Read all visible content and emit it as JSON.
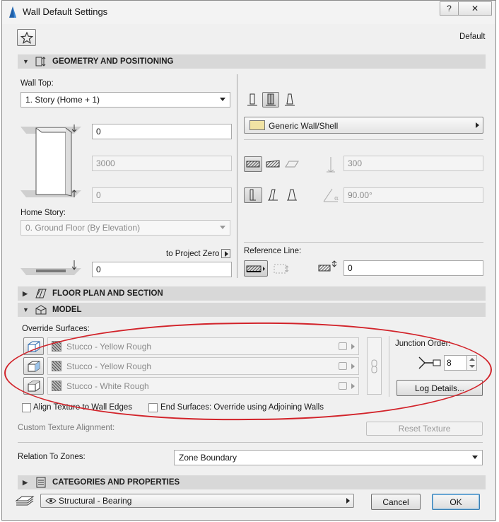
{
  "window": {
    "title": "Wall Default Settings",
    "help_label": "?",
    "close_label": "✕"
  },
  "header": {
    "favorite_icon": "star-icon",
    "default_label": "Default"
  },
  "geometry": {
    "section_label": "GEOMETRY AND POSITIONING",
    "wall_top_label": "Wall Top:",
    "wall_top_value": "1. Story (Home + 1)",
    "top_offset_value": "0",
    "height_value": "3000",
    "bottom_offset_value": "0",
    "home_story_label": "Home Story:",
    "home_story_value": "0. Ground Floor (By Elevation)",
    "to_project_zero_label": "to Project Zero",
    "project_zero_value": "0",
    "composite_value": "Generic Wall/Shell",
    "thickness_value": "300",
    "angle_value": "90.00°",
    "reference_line_label": "Reference Line:",
    "reference_offset_value": "0"
  },
  "floor_plan": {
    "section_label": "FLOOR PLAN AND SECTION"
  },
  "model": {
    "section_label": "MODEL",
    "override_surfaces_label": "Override Surfaces:",
    "surfaces": [
      "Stucco - Yellow Rough",
      "Stucco - Yellow Rough",
      "Stucco - White Rough"
    ],
    "junction_order_label": "Junction Order:",
    "junction_order_value": "8",
    "log_details_label": "Log Details...",
    "align_texture_label": "Align Texture to Wall Edges",
    "align_texture_checked": false,
    "end_surfaces_label": "End Surfaces: Override using Adjoining Walls",
    "end_surfaces_checked": false,
    "custom_texture_label": "Custom Texture Alignment:",
    "reset_texture_label": "Reset Texture",
    "relation_label": "Relation To Zones:",
    "relation_value": "Zone Boundary"
  },
  "categories": {
    "section_label": "CATEGORIES AND PROPERTIES"
  },
  "footer": {
    "layer_value": "Structural - Bearing",
    "cancel_label": "Cancel",
    "ok_label": "OK"
  },
  "colors": {
    "annotation_red": "#d2232a",
    "header_bg": "#d8d8d8"
  }
}
